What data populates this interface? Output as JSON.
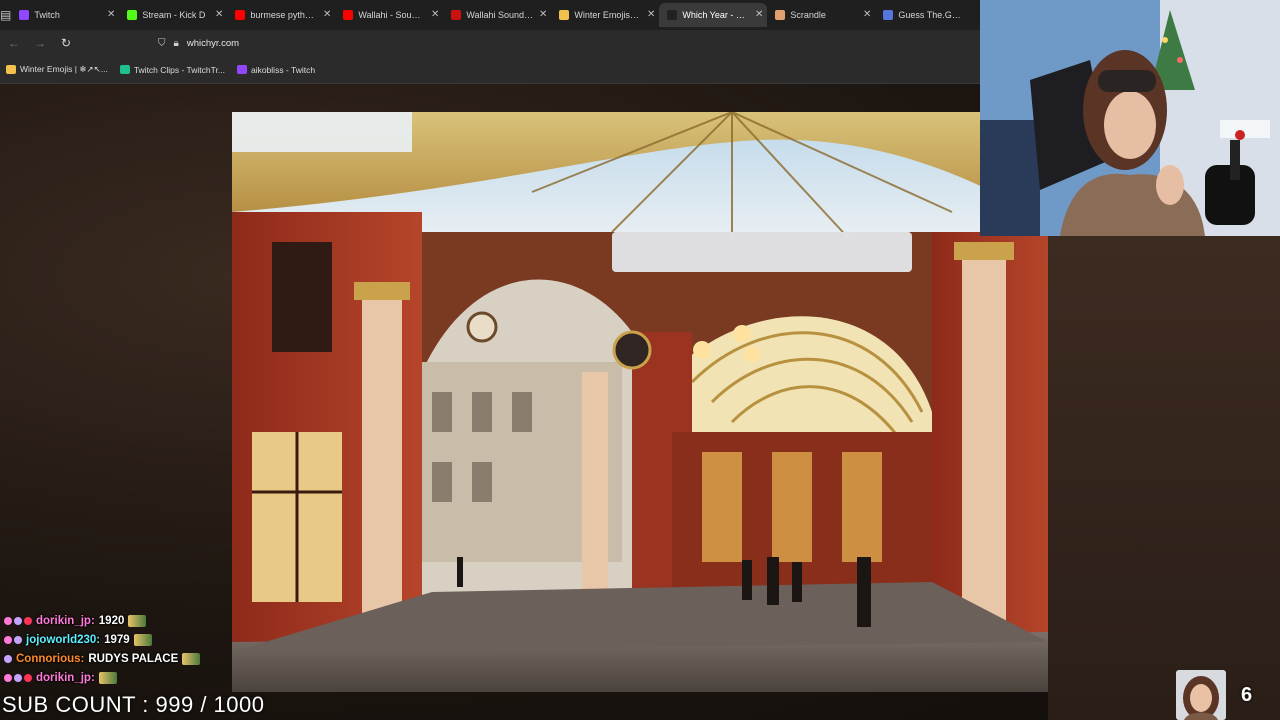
{
  "browser": {
    "menu_icon": "tab-search-icon",
    "tabs": [
      {
        "label": "Twitch",
        "favicon_color": "#9146ff",
        "close": "✕",
        "active": false
      },
      {
        "label": "Stream - Kick D",
        "favicon_color": "#53fc18",
        "close": "✕",
        "active": false
      },
      {
        "label": "burmese python - Y",
        "favicon_color": "#ff0000",
        "close": "✕",
        "active": false
      },
      {
        "label": "Wallahi - Sound Effe",
        "favicon_color": "#ff0000",
        "close": "✕",
        "active": false
      },
      {
        "label": "Wallahi Soundboard",
        "favicon_color": "#cc1111",
        "close": "✕",
        "active": false
      },
      {
        "label": "Winter Emojis | ❄↗",
        "favicon_color": "#f2c14e",
        "close": "✕",
        "active": false
      },
      {
        "label": "Which Year - Photo",
        "favicon_color": "#222222",
        "close": "✕",
        "active": true
      },
      {
        "label": "Scrandle",
        "favicon_color": "#e0a070",
        "close": "✕",
        "active": false
      },
      {
        "label": "Guess The.Game #",
        "favicon_color": "#5577dd",
        "close": "",
        "active": false
      }
    ],
    "url": "whichyr.com",
    "bookmarks": [
      {
        "label": "Winter Emojis | ❄↗↖...",
        "color": "#f2c14e"
      },
      {
        "label": "Twitch Clips - TwitchTr...",
        "color": "#1fbf8f"
      },
      {
        "label": "aikobliss - Twitch",
        "color": "#9146ff"
      }
    ]
  },
  "chat": [
    {
      "user": "dorikin_jp:",
      "message": "1920",
      "user_color": "#ff7ad9",
      "badge_colors": [
        "#ff7ad9",
        "#c6a3ff",
        "#ff3355"
      ]
    },
    {
      "user": "jojoworld230:",
      "message": "1979",
      "user_color": "#5cf0ff",
      "badge_colors": [
        "#ff7ad9",
        "#c6a3ff"
      ]
    },
    {
      "user": "Connorious:",
      "message": "RUDYS PALACE",
      "user_color": "#ff8a2a",
      "badge_colors": [
        "#c6a3ff"
      ]
    },
    {
      "user": "dorikin_jp:",
      "message": "",
      "user_color": "#ff7ad9",
      "badge_colors": [
        "#ff7ad9",
        "#c6a3ff",
        "#ff3355"
      ]
    }
  ],
  "sub_count": "SUB COUNT : 999 / 1000",
  "round_number": "6"
}
